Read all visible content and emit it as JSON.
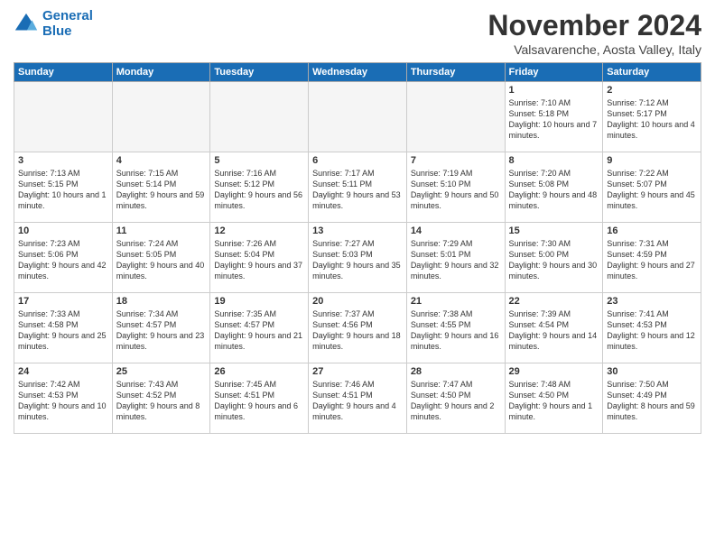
{
  "logo": {
    "line1": "General",
    "line2": "Blue"
  },
  "title": "November 2024",
  "location": "Valsavarenche, Aosta Valley, Italy",
  "days_of_week": [
    "Sunday",
    "Monday",
    "Tuesday",
    "Wednesday",
    "Thursday",
    "Friday",
    "Saturday"
  ],
  "weeks": [
    [
      {
        "day": "",
        "empty": true
      },
      {
        "day": "",
        "empty": true
      },
      {
        "day": "",
        "empty": true
      },
      {
        "day": "",
        "empty": true
      },
      {
        "day": "",
        "empty": true
      },
      {
        "day": "1",
        "sunrise": "Sunrise: 7:10 AM",
        "sunset": "Sunset: 5:18 PM",
        "daylight": "Daylight: 10 hours and 7 minutes."
      },
      {
        "day": "2",
        "sunrise": "Sunrise: 7:12 AM",
        "sunset": "Sunset: 5:17 PM",
        "daylight": "Daylight: 10 hours and 4 minutes."
      }
    ],
    [
      {
        "day": "3",
        "sunrise": "Sunrise: 7:13 AM",
        "sunset": "Sunset: 5:15 PM",
        "daylight": "Daylight: 10 hours and 1 minute."
      },
      {
        "day": "4",
        "sunrise": "Sunrise: 7:15 AM",
        "sunset": "Sunset: 5:14 PM",
        "daylight": "Daylight: 9 hours and 59 minutes."
      },
      {
        "day": "5",
        "sunrise": "Sunrise: 7:16 AM",
        "sunset": "Sunset: 5:12 PM",
        "daylight": "Daylight: 9 hours and 56 minutes."
      },
      {
        "day": "6",
        "sunrise": "Sunrise: 7:17 AM",
        "sunset": "Sunset: 5:11 PM",
        "daylight": "Daylight: 9 hours and 53 minutes."
      },
      {
        "day": "7",
        "sunrise": "Sunrise: 7:19 AM",
        "sunset": "Sunset: 5:10 PM",
        "daylight": "Daylight: 9 hours and 50 minutes."
      },
      {
        "day": "8",
        "sunrise": "Sunrise: 7:20 AM",
        "sunset": "Sunset: 5:08 PM",
        "daylight": "Daylight: 9 hours and 48 minutes."
      },
      {
        "day": "9",
        "sunrise": "Sunrise: 7:22 AM",
        "sunset": "Sunset: 5:07 PM",
        "daylight": "Daylight: 9 hours and 45 minutes."
      }
    ],
    [
      {
        "day": "10",
        "sunrise": "Sunrise: 7:23 AM",
        "sunset": "Sunset: 5:06 PM",
        "daylight": "Daylight: 9 hours and 42 minutes."
      },
      {
        "day": "11",
        "sunrise": "Sunrise: 7:24 AM",
        "sunset": "Sunset: 5:05 PM",
        "daylight": "Daylight: 9 hours and 40 minutes."
      },
      {
        "day": "12",
        "sunrise": "Sunrise: 7:26 AM",
        "sunset": "Sunset: 5:04 PM",
        "daylight": "Daylight: 9 hours and 37 minutes."
      },
      {
        "day": "13",
        "sunrise": "Sunrise: 7:27 AM",
        "sunset": "Sunset: 5:03 PM",
        "daylight": "Daylight: 9 hours and 35 minutes."
      },
      {
        "day": "14",
        "sunrise": "Sunrise: 7:29 AM",
        "sunset": "Sunset: 5:01 PM",
        "daylight": "Daylight: 9 hours and 32 minutes."
      },
      {
        "day": "15",
        "sunrise": "Sunrise: 7:30 AM",
        "sunset": "Sunset: 5:00 PM",
        "daylight": "Daylight: 9 hours and 30 minutes."
      },
      {
        "day": "16",
        "sunrise": "Sunrise: 7:31 AM",
        "sunset": "Sunset: 4:59 PM",
        "daylight": "Daylight: 9 hours and 27 minutes."
      }
    ],
    [
      {
        "day": "17",
        "sunrise": "Sunrise: 7:33 AM",
        "sunset": "Sunset: 4:58 PM",
        "daylight": "Daylight: 9 hours and 25 minutes."
      },
      {
        "day": "18",
        "sunrise": "Sunrise: 7:34 AM",
        "sunset": "Sunset: 4:57 PM",
        "daylight": "Daylight: 9 hours and 23 minutes."
      },
      {
        "day": "19",
        "sunrise": "Sunrise: 7:35 AM",
        "sunset": "Sunset: 4:57 PM",
        "daylight": "Daylight: 9 hours and 21 minutes."
      },
      {
        "day": "20",
        "sunrise": "Sunrise: 7:37 AM",
        "sunset": "Sunset: 4:56 PM",
        "daylight": "Daylight: 9 hours and 18 minutes."
      },
      {
        "day": "21",
        "sunrise": "Sunrise: 7:38 AM",
        "sunset": "Sunset: 4:55 PM",
        "daylight": "Daylight: 9 hours and 16 minutes."
      },
      {
        "day": "22",
        "sunrise": "Sunrise: 7:39 AM",
        "sunset": "Sunset: 4:54 PM",
        "daylight": "Daylight: 9 hours and 14 minutes."
      },
      {
        "day": "23",
        "sunrise": "Sunrise: 7:41 AM",
        "sunset": "Sunset: 4:53 PM",
        "daylight": "Daylight: 9 hours and 12 minutes."
      }
    ],
    [
      {
        "day": "24",
        "sunrise": "Sunrise: 7:42 AM",
        "sunset": "Sunset: 4:53 PM",
        "daylight": "Daylight: 9 hours and 10 minutes."
      },
      {
        "day": "25",
        "sunrise": "Sunrise: 7:43 AM",
        "sunset": "Sunset: 4:52 PM",
        "daylight": "Daylight: 9 hours and 8 minutes."
      },
      {
        "day": "26",
        "sunrise": "Sunrise: 7:45 AM",
        "sunset": "Sunset: 4:51 PM",
        "daylight": "Daylight: 9 hours and 6 minutes."
      },
      {
        "day": "27",
        "sunrise": "Sunrise: 7:46 AM",
        "sunset": "Sunset: 4:51 PM",
        "daylight": "Daylight: 9 hours and 4 minutes."
      },
      {
        "day": "28",
        "sunrise": "Sunrise: 7:47 AM",
        "sunset": "Sunset: 4:50 PM",
        "daylight": "Daylight: 9 hours and 2 minutes."
      },
      {
        "day": "29",
        "sunrise": "Sunrise: 7:48 AM",
        "sunset": "Sunset: 4:50 PM",
        "daylight": "Daylight: 9 hours and 1 minute."
      },
      {
        "day": "30",
        "sunrise": "Sunrise: 7:50 AM",
        "sunset": "Sunset: 4:49 PM",
        "daylight": "Daylight: 8 hours and 59 minutes."
      }
    ]
  ]
}
